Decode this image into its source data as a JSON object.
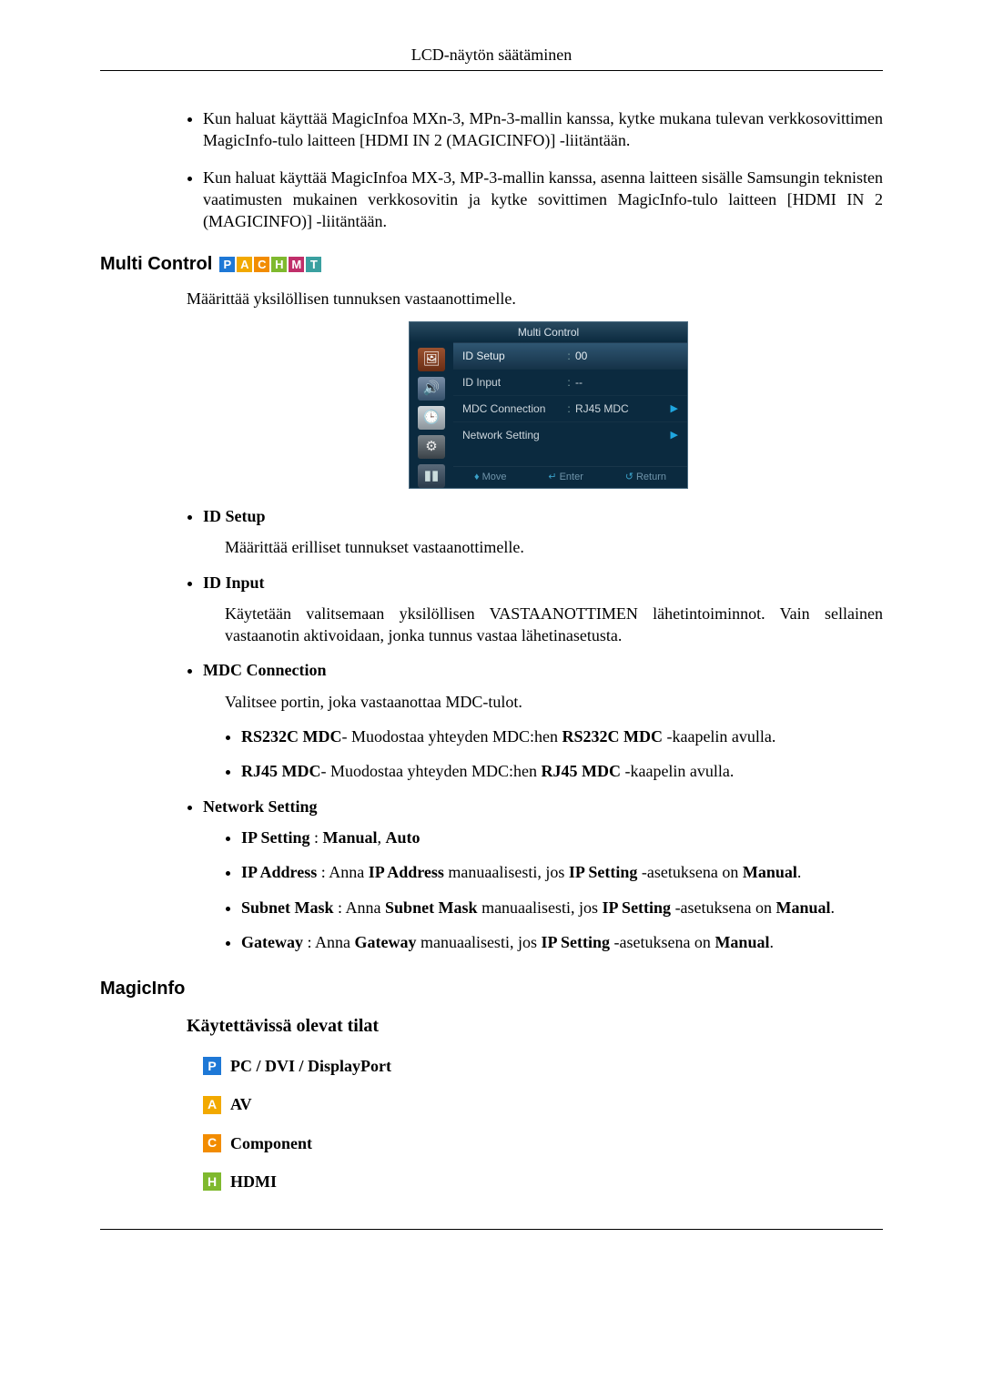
{
  "header": {
    "title": "LCD-näytön säätäminen"
  },
  "intro_bullets": [
    "Kun haluat käyttää MagicInfoa MXn-3, MPn-3-mallin kanssa, kytke mukana tulevan verkkosovittimen MagicInfo-tulo laitteen [HDMI IN 2 (MAGICINFO)] -liitäntään.",
    "Kun haluat käyttää MagicInfoa MX-3, MP-3-mallin kanssa, asenna laitteen sisälle Samsungin teknisten vaatimusten mukainen verkkosovitin ja kytke sovittimen MagicInfo-tulo laitteen [HDMI IN 2 (MAGICINFO)] -liitäntään."
  ],
  "multi_control": {
    "heading": "Multi Control",
    "badges": [
      "P",
      "A",
      "C",
      "H",
      "M",
      "T"
    ],
    "intro": "Määrittää yksilöllisen tunnuksen vastaanottimelle.",
    "osd": {
      "title": "Multi Control",
      "rows": [
        {
          "label": "ID Setup",
          "value": "00",
          "selected": true,
          "colon": true,
          "arrow": false
        },
        {
          "label": "ID Input",
          "value": "--",
          "selected": false,
          "colon": true,
          "arrow": false
        },
        {
          "label": "MDC Connection",
          "value": "RJ45 MDC",
          "selected": false,
          "colon": true,
          "arrow": true
        },
        {
          "label": "Network Setting",
          "value": "",
          "selected": false,
          "colon": false,
          "arrow": true
        }
      ],
      "footer": {
        "move": "Move",
        "enter": "Enter",
        "return": "Return"
      }
    },
    "items": {
      "id_setup": {
        "title": "ID Setup",
        "desc": "Määrittää erilliset tunnukset vastaanottimelle."
      },
      "id_input": {
        "title": "ID Input",
        "desc": "Käytetään valitsemaan yksilöllisen VASTAANOTTIMEN lähetintoiminnot. Vain sellainen vastaanotin aktivoidaan, jonka tunnus vastaa lähetinasetusta."
      },
      "mdc": {
        "title": "MDC Connection",
        "desc": "Valitsee portin, joka vastaanottaa MDC-tulot.",
        "opts": {
          "rs": {
            "b1": "RS232C MDC",
            "t1": "- Muodostaa yhteyden MDC:hen ",
            "b2": "RS232C MDC",
            "t2": " -kaapelin avulla."
          },
          "rj": {
            "b1": "RJ45 MDC",
            "t1": "- Muodostaa yhteyden MDC:hen ",
            "b2": "RJ45 MDC",
            "t2": " -kaapelin avulla."
          }
        }
      },
      "net": {
        "title": "Network Setting",
        "opts": {
          "ip_setting": {
            "b1": "IP Setting",
            "t1": " : ",
            "b2": "Manual",
            "t2": ", ",
            "b3": "Auto"
          },
          "ip_addr": {
            "b1": "IP Address",
            "t1": " : Anna ",
            "b2": "IP Address",
            "t2": " manuaalisesti, jos ",
            "b3": "IP Setting",
            "t3": " -asetuksena on ",
            "b4": "Manual",
            "t4": "."
          },
          "subnet": {
            "b1": "Subnet Mask",
            "t1": " : Anna ",
            "b2": "Subnet Mask",
            "t2": " manuaalisesti, jos ",
            "b3": "IP Setting",
            "t3": " -asetuksena on ",
            "b4": "Manual",
            "t4": "."
          },
          "gateway": {
            "b1": "Gateway",
            "t1": " : Anna ",
            "b2": "Gateway",
            "t2": " manuaalisesti, jos ",
            "b3": "IP Setting",
            "t3": " -asetuksena on ",
            "b4": "Manual",
            "t4": "."
          }
        }
      }
    }
  },
  "magicinfo": {
    "heading": "MagicInfo",
    "sub": "Käytettävissä olevat tilat",
    "modes": [
      {
        "badge": "P",
        "cls": "b-P",
        "label": "PC / DVI / DisplayPort"
      },
      {
        "badge": "A",
        "cls": "b-A",
        "label": "AV"
      },
      {
        "badge": "C",
        "cls": "b-C",
        "label": "Component"
      },
      {
        "badge": "H",
        "cls": "b-H",
        "label": "HDMI"
      }
    ]
  }
}
